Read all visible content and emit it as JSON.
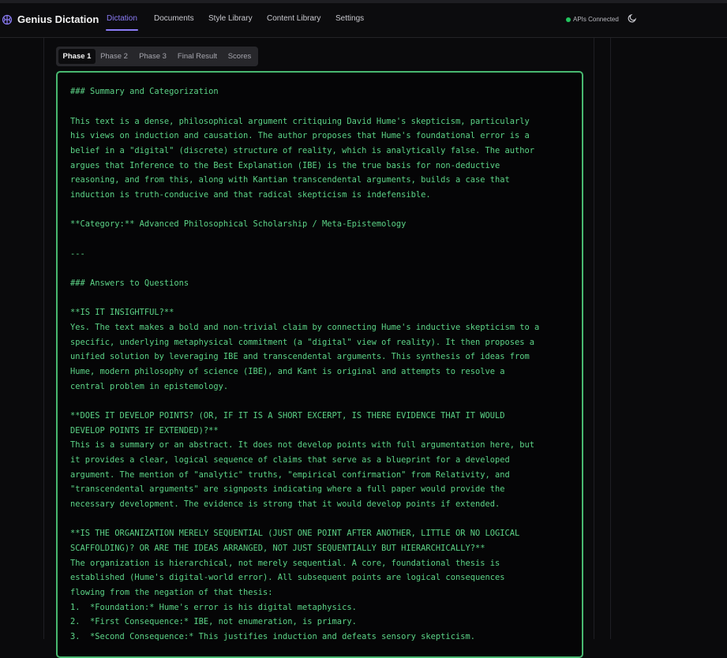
{
  "app": {
    "title": "Genius Dictation"
  },
  "nav": {
    "items": [
      {
        "label": "Dictation",
        "active": true
      },
      {
        "label": "Documents"
      },
      {
        "label": "Style Library"
      },
      {
        "label": "Content Library"
      },
      {
        "label": "Settings"
      }
    ],
    "status_text": "APIs Connected",
    "status_color": "#22c55e",
    "accent_color": "#8b7cf6",
    "brand_icon": "brain-icon",
    "theme_icon": "moon-icon"
  },
  "tabs": [
    {
      "label": "Phase 1",
      "active": true
    },
    {
      "label": "Phase 2"
    },
    {
      "label": "Phase 3"
    },
    {
      "label": "Final Result"
    },
    {
      "label": "Scores"
    }
  ],
  "output": {
    "text_color": "#5cd487",
    "border_color": "#48b870",
    "lines": [
      "### Summary and Categorization",
      "",
      "This text is a dense, philosophical argument critiquing David Hume's skepticism, particularly",
      "his views on induction and causation. The author proposes that Hume's foundational error is a",
      "belief in a \"digital\" (discrete) structure of reality, which is analytically false. The author",
      "argues that Inference to the Best Explanation (IBE) is the true basis for non-deductive",
      "reasoning, and from this, along with Kantian transcendental arguments, builds a case that",
      "induction is truth-conducive and that radical skepticism is indefensible.",
      "",
      "**Category:** Advanced Philosophical Scholarship / Meta-Epistemology",
      "",
      "---",
      "",
      "### Answers to Questions",
      "",
      "**IS IT INSIGHTFUL?**",
      "Yes. The text makes a bold and non-trivial claim by connecting Hume's inductive skepticism to a",
      "specific, underlying metaphysical commitment (a \"digital\" view of reality). It then proposes a",
      "unified solution by leveraging IBE and transcendental arguments. This synthesis of ideas from",
      "Hume, modern philosophy of science (IBE), and Kant is original and attempts to resolve a",
      "central problem in epistemology.",
      "",
      "**DOES IT DEVELOP POINTS? (OR, IF IT IS A SHORT EXCERPT, IS THERE EVIDENCE THAT IT WOULD",
      "DEVELOP POINTS IF EXTENDED)?**",
      "This is a summary or an abstract. It does not develop points with full argumentation here, but",
      "it provides a clear, logical sequence of claims that serve as a blueprint for a developed",
      "argument. The mention of \"analytic\" truths, \"empirical confirmation\" from Relativity, and",
      "\"transcendental arguments\" are signposts indicating where a full paper would provide the",
      "necessary development. The evidence is strong that it would develop points if extended.",
      "",
      "**IS THE ORGANIZATION MERELY SEQUENTIAL (JUST ONE POINT AFTER ANOTHER, LITTLE OR NO LOGICAL",
      "SCAFFOLDING)? OR ARE THE IDEAS ARRANGED, NOT JUST SEQUENTIALLY BUT HIERARCHICALLY?**",
      "The organization is hierarchical, not merely sequential. A core, foundational thesis is",
      "established (Hume's digital-world error). All subsequent points are logical consequences",
      "flowing from the negation of that thesis:",
      "1.  *Foundation:* Hume's error is his digital metaphysics.",
      "2.  *First Consequence:* IBE, not enumeration, is primary.",
      "3.  *Second Consequence:* This justifies induction and defeats sensory skepticism."
    ]
  }
}
